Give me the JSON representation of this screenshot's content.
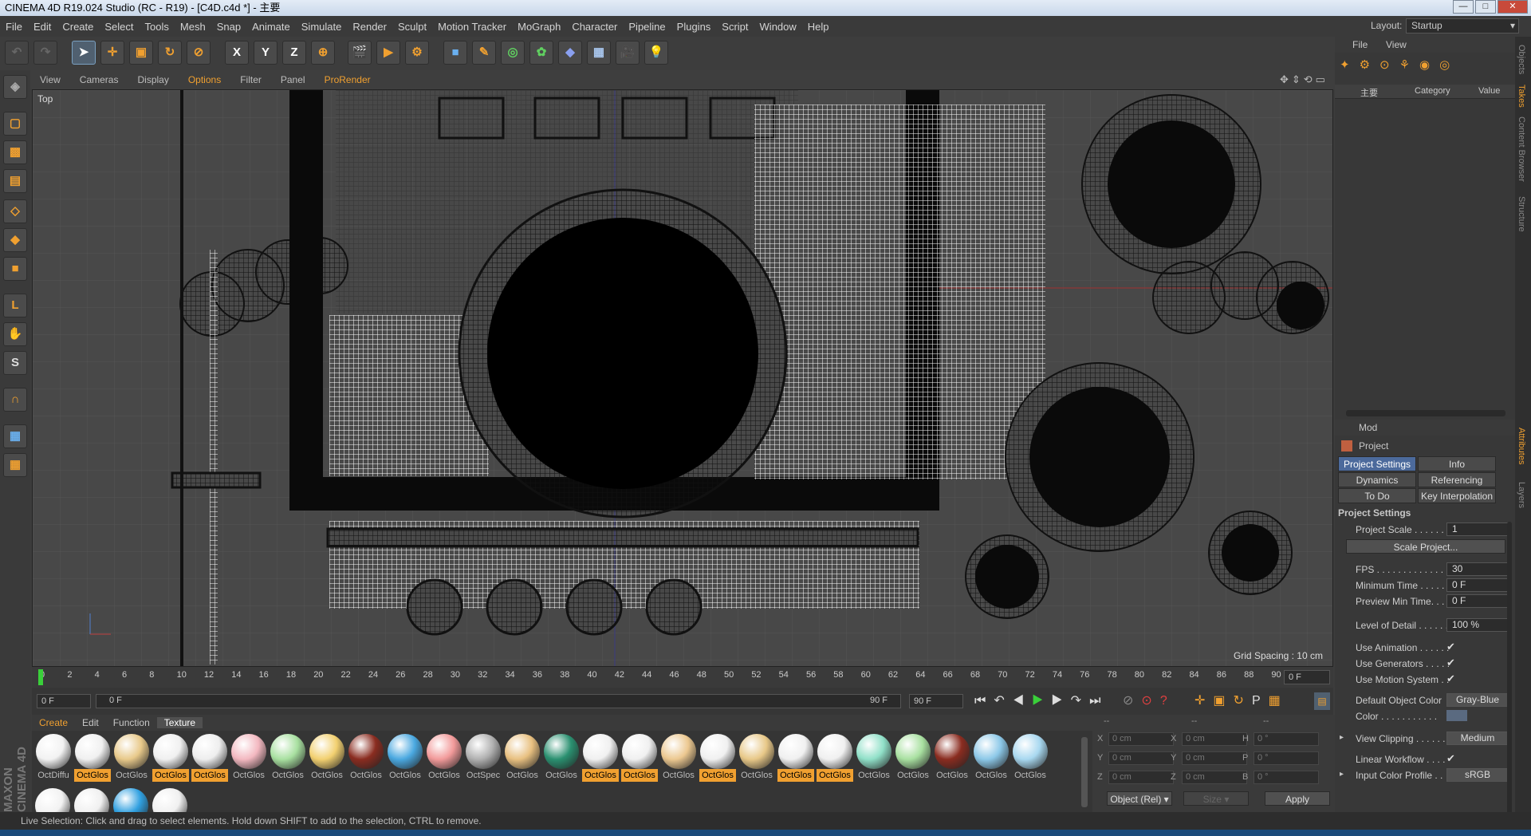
{
  "window": {
    "title": "CINEMA 4D R19.024 Studio (RC - R19) - [C4D.c4d *] - 主要",
    "minimize": "—",
    "maximize": "□",
    "close": "✕"
  },
  "menu": [
    "File",
    "Edit",
    "Create",
    "Select",
    "Tools",
    "Mesh",
    "Snap",
    "Animate",
    "Simulate",
    "Render",
    "Sculpt",
    "Motion Tracker",
    "MoGraph",
    "Character",
    "Pipeline",
    "Plugins",
    "Script",
    "Window",
    "Help"
  ],
  "layout": {
    "label": "Layout:",
    "value": "Startup"
  },
  "viewport_menu": [
    "View",
    "Cameras",
    "Display",
    "Options",
    "Filter",
    "Panel",
    "ProRender"
  ],
  "viewport": {
    "name": "Top",
    "grid_spacing": "Grid Spacing : 10 cm"
  },
  "timeline": {
    "ticks": [
      "0",
      "2",
      "4",
      "6",
      "8",
      "10",
      "12",
      "14",
      "16",
      "18",
      "20",
      "22",
      "24",
      "26",
      "28",
      "30",
      "32",
      "34",
      "36",
      "38",
      "40",
      "42",
      "44",
      "46",
      "48",
      "50",
      "52",
      "54",
      "56",
      "58",
      "60",
      "62",
      "64",
      "66",
      "68",
      "70",
      "72",
      "74",
      "76",
      "78",
      "80",
      "82",
      "84",
      "86",
      "88",
      "90"
    ],
    "current_frame": "0 F"
  },
  "transport": {
    "start": "0 F",
    "range_start": "0 F",
    "range_end": "90 F",
    "end": "90 F"
  },
  "material_tabs": [
    "Create",
    "Edit",
    "Function",
    "Texture"
  ],
  "materials": [
    {
      "label": "OctDiffu",
      "color": "#f2f2f2",
      "hl": false
    },
    {
      "label": "OctGlos",
      "color": "#f0f0f0",
      "hl": true
    },
    {
      "label": "OctGlos",
      "color": "#e8c98a",
      "hl": false
    },
    {
      "label": "OctGlos",
      "color": "#f0f0f0",
      "hl": true
    },
    {
      "label": "OctGlos",
      "color": "#eeeeee",
      "hl": true
    },
    {
      "label": "OctGlos",
      "color": "#f3b8c0",
      "hl": false
    },
    {
      "label": "OctGlos",
      "color": "#a8e0a0",
      "hl": false
    },
    {
      "label": "OctGlos",
      "color": "#f2d070",
      "hl": false
    },
    {
      "label": "OctGlos",
      "color": "#8a2c20",
      "hl": false
    },
    {
      "label": "OctGlos",
      "color": "#4aa8e0",
      "hl": false
    },
    {
      "label": "OctGlos",
      "color": "#f29a9a",
      "hl": false
    },
    {
      "label": "OctSpec",
      "color": "#b0b0b0",
      "hl": false
    },
    {
      "label": "OctGlos",
      "color": "#e8c080",
      "hl": false
    },
    {
      "label": "OctGlos",
      "color": "#2a9070",
      "hl": false
    },
    {
      "label": "OctGlos",
      "color": "#f0f0f0",
      "hl": true
    },
    {
      "label": "OctGlos",
      "color": "#f0f0f0",
      "hl": true
    },
    {
      "label": "OctGlos",
      "color": "#ecc890",
      "hl": false
    },
    {
      "label": "OctGlos",
      "color": "#f0f0f0",
      "hl": true
    },
    {
      "label": "OctGlos",
      "color": "#e8c888",
      "hl": false
    },
    {
      "label": "OctGlos",
      "color": "#f0f0f0",
      "hl": true
    },
    {
      "label": "OctGlos",
      "color": "#f0f0f0",
      "hl": true
    },
    {
      "label": "OctGlos",
      "color": "#90e0c8",
      "hl": false
    },
    {
      "label": "OctGlos",
      "color": "#a8e0a0",
      "hl": false
    },
    {
      "label": "OctGlos",
      "color": "#8a2c20",
      "hl": false
    },
    {
      "label": "OctGlos",
      "color": "#8cc8e8",
      "hl": false
    },
    {
      "label": "OctGlos",
      "color": "#a8d8f0",
      "hl": false
    }
  ],
  "materials_row2": [
    "#f2f2f2",
    "#f0f0f0",
    "#30a0e0",
    "#f0f0f0"
  ],
  "coords": {
    "headers": [
      "--",
      "--",
      "--"
    ],
    "rows": [
      {
        "a": "X",
        "av": "0 cm",
        "b": "X",
        "bv": "0 cm",
        "c": "H",
        "cv": "0 °"
      },
      {
        "a": "Y",
        "av": "0 cm",
        "b": "Y",
        "bv": "0 cm",
        "c": "P",
        "cv": "0 °"
      },
      {
        "a": "Z",
        "av": "0 cm",
        "b": "Z",
        "bv": "0 cm",
        "c": "B",
        "cv": "0 °"
      }
    ],
    "mode": "Object (Rel)",
    "size": "Size",
    "apply": "Apply"
  },
  "object_manager": {
    "menu": [
      "File",
      "View"
    ],
    "root": "主要",
    "col_category": "Category",
    "col_value": "Value"
  },
  "attributes": {
    "mode": "Mod",
    "title": "Project",
    "tabs": [
      "Project Settings",
      "Info",
      "Dynamics",
      "Referencing",
      "To Do",
      "Key Interpolation"
    ],
    "section": "Project Settings",
    "project_scale_label": "Project Scale . . . . . . .",
    "project_scale": "1",
    "scale_button": "Scale Project...",
    "fps_label": "FPS . . . . . . . . . . . . . . .",
    "fps": "30",
    "min_time_label": "Minimum Time . . . . . . .",
    "min_time": "0 F",
    "preview_min_label": "Preview Min Time. . . .",
    "preview_min": "0 F",
    "lod_label": "Level of Detail . . . . . .",
    "lod": "100 %",
    "use_animation": "Use Animation . . . . . .",
    "use_generators": "Use Generators . . . . .",
    "use_motion": "Use Motion System . .",
    "default_color_label": "Default Object Color",
    "default_color": "Gray-Blue",
    "color_label": "Color . . . . . . . . . . .",
    "view_clipping_label": "View Clipping . . . . . .",
    "view_clipping": "Medium",
    "linear_workflow": "Linear Workflow . . . .",
    "input_profile_label": "Input Color Profile . .",
    "input_profile": "sRGB"
  },
  "right_tabs": [
    "Objects",
    "Takes",
    "Content Browser",
    "Structure",
    "Attributes",
    "Layers"
  ],
  "status": "Live Selection: Click and drag to select elements. Hold down SHIFT to add to the selection, CTRL to remove.",
  "logo": "MAXON CINEMA 4D"
}
